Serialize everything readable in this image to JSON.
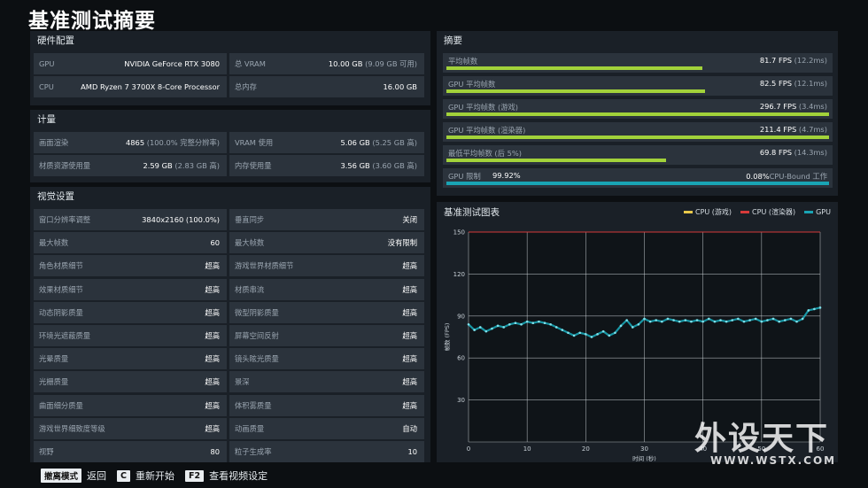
{
  "page_title": "基准测试摘要",
  "hardware": {
    "title": "硬件配置",
    "rows": [
      [
        {
          "label": "GPU",
          "value": "NVIDIA GeForce RTX 3080",
          "sub": ""
        },
        {
          "label": "总 VRAM",
          "value": "10.00 GB",
          "sub": "(9.09 GB 可用)"
        }
      ],
      [
        {
          "label": "CPU",
          "value": "AMD Ryzen 7 3700X 8-Core Processor",
          "sub": ""
        },
        {
          "label": "总内存",
          "value": "16.00 GB",
          "sub": ""
        }
      ]
    ]
  },
  "metrics": {
    "title": "计量",
    "rows": [
      [
        {
          "label": "画面渲染",
          "value": "4865",
          "sub": "(100.0% 完整分辨率)"
        },
        {
          "label": "VRAM 使用",
          "value": "5.06 GB",
          "sub": "(5.25 GB 高)"
        }
      ],
      [
        {
          "label": "材质资源使用量",
          "value": "2.59 GB",
          "sub": "(2.83 GB 高)"
        },
        {
          "label": "内存使用量",
          "value": "3.56 GB",
          "sub": "(3.60 GB 高)"
        }
      ]
    ]
  },
  "visual": {
    "title": "视觉设置",
    "rows": [
      [
        {
          "label": "窗口分辨率调整",
          "value": "3840x2160 (100.0%)"
        },
        {
          "label": "垂直同步",
          "value": "关闭"
        }
      ],
      [
        {
          "label": "最大帧数",
          "value": "60"
        },
        {
          "label": "最大帧数",
          "value": "没有限制"
        }
      ],
      [
        {
          "label": "角色材质细节",
          "value": "超高"
        },
        {
          "label": "游戏世界材质细节",
          "value": "超高"
        }
      ],
      [
        {
          "label": "效果材质细节",
          "value": "超高"
        },
        {
          "label": "材质串流",
          "value": "超高"
        }
      ],
      [
        {
          "label": "动态阴影质量",
          "value": "超高"
        },
        {
          "label": "微型阴影质量",
          "value": "超高"
        }
      ],
      [
        {
          "label": "环境光遮蔽质量",
          "value": "超高"
        },
        {
          "label": "屏幕空间反射",
          "value": "超高"
        }
      ],
      [
        {
          "label": "光晕质量",
          "value": "超高"
        },
        {
          "label": "镜头眩光质量",
          "value": "超高"
        }
      ],
      [
        {
          "label": "光栅质量",
          "value": "超高"
        },
        {
          "label": "景深",
          "value": "超高"
        }
      ],
      [
        {
          "label": "曲面细分质量",
          "value": "超高"
        },
        {
          "label": "体积雾质量",
          "value": "超高"
        }
      ],
      [
        {
          "label": "游戏世界细致度等级",
          "value": "超高"
        },
        {
          "label": "动画质量",
          "value": "自动"
        }
      ],
      [
        {
          "label": "视野",
          "value": "80"
        },
        {
          "label": "粒子生成率",
          "value": "10"
        }
      ]
    ]
  },
  "summary": {
    "title": "摘要",
    "rows": [
      {
        "label": "平均帧数",
        "value": "81.7 FPS",
        "sub": "(12.2ms)",
        "fill": 0.67,
        "color": "#a2d23a"
      },
      {
        "label": "GPU 平均帧数",
        "value": "82.5 FPS",
        "sub": "(12.1ms)",
        "fill": 0.675,
        "color": "#a2d23a"
      },
      {
        "label": "GPU 平均帧数 (游戏)",
        "value": "296.7 FPS",
        "sub": "(3.4ms)",
        "fill": 1.0,
        "color": "#a2d23a"
      },
      {
        "label": "GPU 平均帧数 (渲染器)",
        "value": "211.4 FPS",
        "sub": "(4.7ms)",
        "fill": 1.0,
        "color": "#a2d23a"
      },
      {
        "label": "最低平均帧数 (后 5%)",
        "value": "69.8 FPS",
        "sub": "(14.3ms)",
        "fill": 0.575,
        "color": "#a2d23a"
      }
    ],
    "limit": {
      "label": "GPU 限制",
      "gpu_value": "99.92%",
      "cpu_value": "0.08%",
      "cpu_label": "CPU-Bound 工作",
      "fill": 0.9992,
      "color": "#19a4b4"
    }
  },
  "chart": {
    "title": "基准测试图表",
    "legend": [
      {
        "name": "CPU (游戏)",
        "color": "#e8c84a"
      },
      {
        "name": "CPU (渲染器)",
        "color": "#d63a3a"
      },
      {
        "name": "GPU",
        "color": "#19a4b4"
      }
    ]
  },
  "chart_data": {
    "type": "scatter",
    "title": "基准测试图表",
    "xlabel": "时间 (秒)",
    "ylabel": "帧数 (FPS)",
    "xlim": [
      0,
      60
    ],
    "ylim": [
      0,
      150
    ],
    "xticks": [
      0,
      10,
      20,
      30,
      40,
      50,
      60
    ],
    "yticks": [
      0,
      30,
      60,
      90,
      120,
      150
    ],
    "grid": true,
    "legend_position": "top-right",
    "series": [
      {
        "name": "CPU (游戏)",
        "color": "#e8c84a",
        "x": [],
        "y": []
      },
      {
        "name": "CPU (渲染器)",
        "color": "#d63a3a",
        "x": [
          0,
          60
        ],
        "y": [
          150,
          150
        ]
      },
      {
        "name": "GPU",
        "color": "#19a4b4",
        "x": [
          0,
          1,
          2,
          3,
          4,
          5,
          6,
          7,
          8,
          9,
          10,
          11,
          12,
          13,
          14,
          15,
          16,
          17,
          18,
          19,
          20,
          21,
          22,
          23,
          24,
          25,
          26,
          27,
          28,
          29,
          30,
          31,
          32,
          33,
          34,
          35,
          36,
          37,
          38,
          39,
          40,
          41,
          42,
          43,
          44,
          45,
          46,
          47,
          48,
          49,
          50,
          51,
          52,
          53,
          54,
          55,
          56,
          57,
          58,
          59,
          60
        ],
        "y": [
          84,
          80,
          82,
          79,
          81,
          83,
          82,
          84,
          85,
          84,
          86,
          85,
          86,
          85,
          84,
          82,
          80,
          78,
          76,
          78,
          77,
          75,
          77,
          79,
          76,
          78,
          83,
          87,
          82,
          84,
          88,
          86,
          87,
          86,
          88,
          87,
          86,
          87,
          86,
          87,
          86,
          88,
          86,
          87,
          86,
          87,
          88,
          86,
          87,
          88,
          86,
          87,
          88,
          86,
          87,
          88,
          86,
          88,
          94,
          95,
          96
        ]
      }
    ]
  },
  "footer": {
    "items": [
      {
        "key": "撤离模式",
        "label": "返回"
      },
      {
        "key": "C",
        "label": "重新开始"
      },
      {
        "key": "F2",
        "label": "查看视频设定"
      }
    ]
  },
  "watermark": {
    "cn": "外设天下",
    "en": "WWW.WSTX.COM"
  }
}
